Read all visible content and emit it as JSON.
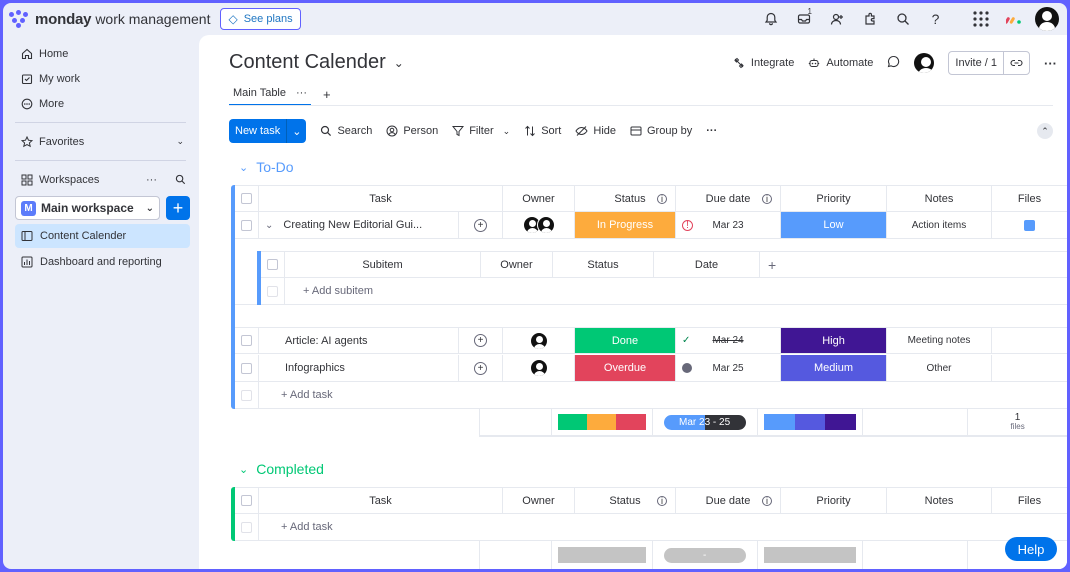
{
  "app": {
    "brand": "monday",
    "brand_sub": "work management",
    "see_plans": "See plans",
    "inbox_badge": "1"
  },
  "sidebar": {
    "home": "Home",
    "my_work": "My work",
    "more": "More",
    "favorites": "Favorites",
    "workspaces": "Workspaces",
    "workspace_badge": "M",
    "workspace_name": "Main workspace",
    "boards": [
      "Content Calender",
      "Dashboard and reporting"
    ]
  },
  "board": {
    "title": "Content Calender",
    "integrate": "Integrate",
    "automate": "Automate",
    "invite": "Invite / 1",
    "tab_main": "Main Table",
    "tab_more": "···",
    "tab_add": "+"
  },
  "toolbar": {
    "new_task": "New task",
    "search": "Search",
    "person": "Person",
    "filter": "Filter",
    "sort": "Sort",
    "hide": "Hide",
    "group_by": "Group by",
    "more": "···"
  },
  "columns": {
    "task": "Task",
    "owner": "Owner",
    "status": "Status",
    "due": "Due date",
    "priority": "Priority",
    "notes": "Notes",
    "files": "Files"
  },
  "subcolumns": {
    "subitem": "Subitem",
    "owner": "Owner",
    "status": "Status",
    "date": "Date",
    "add": "+"
  },
  "groups": [
    {
      "name": "To-Do",
      "color": "#579bfc",
      "rows": [
        {
          "task": "Creating New Editorial Gui...",
          "status": "In Progress",
          "status_color": "#fdab3d",
          "date": "Mar 23",
          "priority": "Low",
          "priority_color": "#579bfc",
          "notes": "Action items"
        },
        {
          "task": "Article: AI agents",
          "status": "Done",
          "status_color": "#00c875",
          "date": "Mar 24",
          "priority": "High",
          "priority_color": "#401694",
          "notes": "Meeting notes"
        },
        {
          "task": "Infographics",
          "status": "Overdue",
          "status_color": "#e2445c",
          "date": "Mar 25",
          "priority": "Medium",
          "priority_color": "#5559df",
          "notes": "Other"
        }
      ],
      "add_subitem": "+ Add subitem",
      "add_task": "+ Add task",
      "summary_date": "Mar 23 - 25",
      "summary_files_count": "1",
      "summary_files_label": "files"
    },
    {
      "name": "Completed",
      "color": "#00c875",
      "rows": [],
      "add_task": "+ Add task",
      "summary_date": "-"
    }
  ],
  "help": "Help"
}
